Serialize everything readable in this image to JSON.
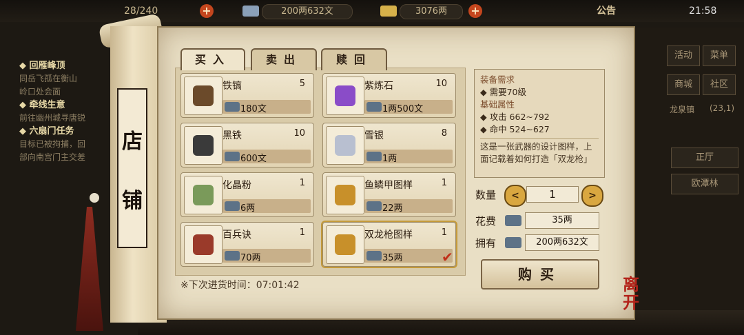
{
  "hud": {
    "storage": "28/240",
    "money_pill": "200两632文",
    "gold_pill": "3076两",
    "notice": "公告",
    "time": "21:58"
  },
  "quests": [
    {
      "title": "◆ 回雁峰顶",
      "lines": [
        "同岳飞孤在衡山",
        "岭口处会面"
      ]
    },
    {
      "title": "◆ 牵线生意",
      "lines": [
        "前往幽州城寻唐锐"
      ]
    },
    {
      "title": "◆ 六扇门任务",
      "lines": [
        "目标已被拘捕，回",
        "部向南宫门主交差"
      ]
    }
  ],
  "side": {
    "activity": "活动",
    "menu": "菜单",
    "mall": "商城",
    "community": "社区",
    "location": "龙泉镇",
    "coords": "(23,1)",
    "hall": "正厅",
    "npc": "欧潭林"
  },
  "scroll_title": [
    "店",
    "铺"
  ],
  "tabs": [
    "买入",
    "卖出",
    "赎回"
  ],
  "items": [
    {
      "name": "铁镐",
      "qty": "5",
      "price": "180文",
      "icon": "pickaxe-icon"
    },
    {
      "name": "紫炼石",
      "qty": "10",
      "price": "1两500文",
      "icon": "purple-ore-icon"
    },
    {
      "name": "黑铁",
      "qty": "10",
      "price": "600文",
      "icon": "black-iron-icon"
    },
    {
      "name": "雪银",
      "qty": "8",
      "price": "1两",
      "icon": "snow-silver-icon"
    },
    {
      "name": "化晶粉",
      "qty": "1",
      "price": "6两",
      "icon": "crystal-powder-icon"
    },
    {
      "name": "鱼鳞甲图样",
      "qty": "1",
      "price": "22两",
      "icon": "blueprint-icon"
    },
    {
      "name": "百兵诀",
      "qty": "1",
      "price": "70两",
      "icon": "manual-icon"
    },
    {
      "name": "双龙枪图样",
      "qty": "1",
      "price": "35两",
      "icon": "blueprint-icon"
    }
  ],
  "restock": {
    "label": "※下次进货时间：",
    "time": "07:01:42"
  },
  "detail": {
    "req_title": "装备需求",
    "req": "◆ 需要70级",
    "attr_title": "基础属性",
    "attack": "◆ 攻击  662~792",
    "hit": "◆ 命中  524~627",
    "desc": "这是一张武器的设计图样，上面记载着如何打造「双龙枪」的方法。"
  },
  "purchase": {
    "qty_label": "数量",
    "qty": "1",
    "cost_label": "花费",
    "cost": "35两",
    "own_label": "拥有",
    "own": "200两632文",
    "buy": "购买",
    "leave": "离开"
  },
  "colors": {
    "parchment": "#e9dfc5",
    "price_bar": "#c8b08a",
    "leave_red": "#b3231a"
  }
}
